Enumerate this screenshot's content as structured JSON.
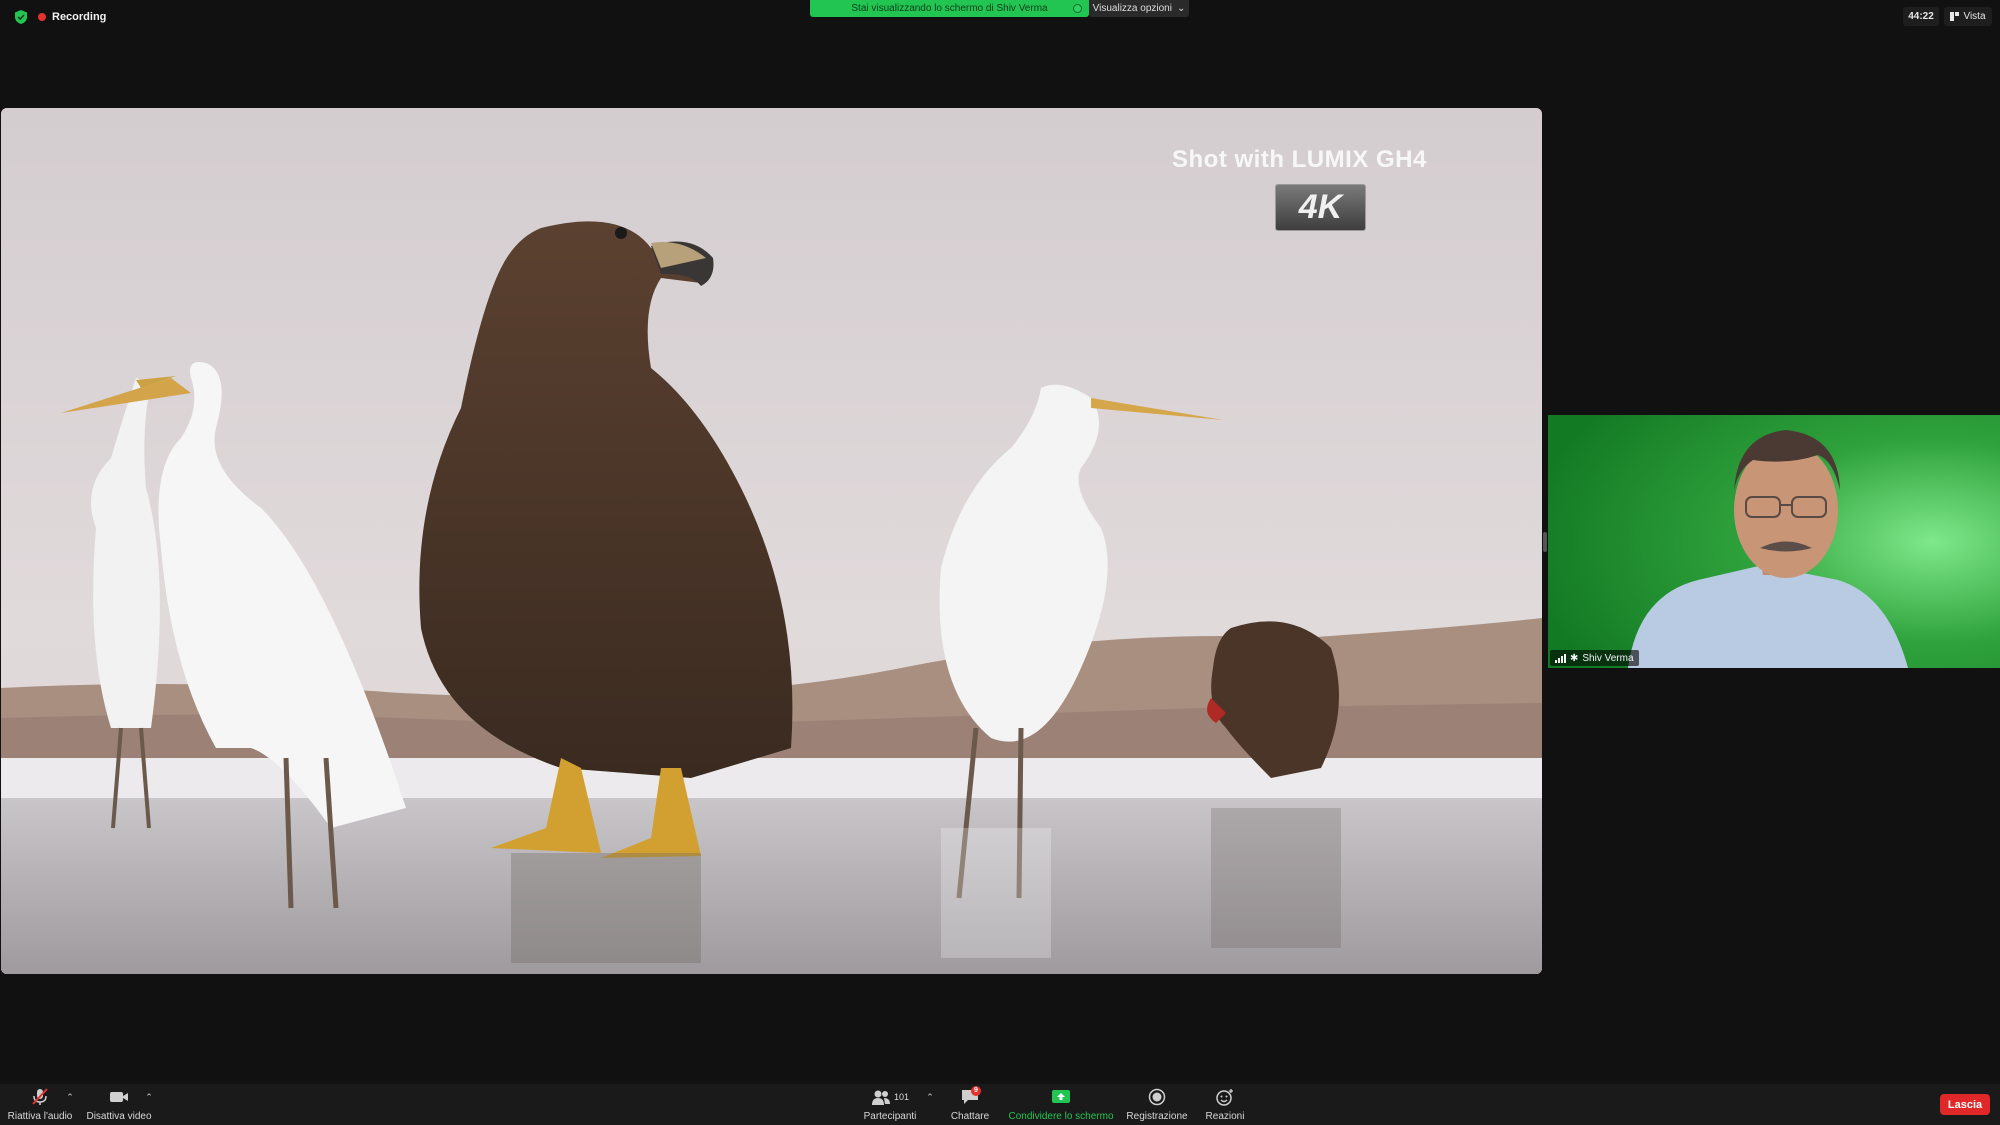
{
  "top_bar": {
    "recording_label": "Recording",
    "share_banner": "Stai visualizzando lo schermo di Shiv Verma",
    "view_options_label": "Visualizza opzioni",
    "meeting_timer": "44:22",
    "view_label": "Vista"
  },
  "shared_content": {
    "overlay_caption": "Shot with LUMIX GH4",
    "resolution_badge": "4K"
  },
  "participant": {
    "name": "Shiv Verma"
  },
  "toolbar": {
    "audio_label": "Riattiva l'audio",
    "video_label": "Disattiva video",
    "participants_label": "Partecipanti",
    "participants_count": "101",
    "chat_label": "Chattare",
    "chat_badge": "9",
    "share_screen_label": "Condividere lo schermo",
    "record_label": "Registrazione",
    "reactions_label": "Reazioni",
    "leave_label": "Lascia"
  },
  "colors": {
    "share_green": "#23c552",
    "leave_red": "#e02828",
    "recording_red": "#e5322d",
    "background": "#111111"
  },
  "icons": [
    "shield-icon",
    "recording-dot-icon",
    "chevron-down-icon",
    "view-icon",
    "microphone-muted-icon",
    "video-camera-icon",
    "participants-icon",
    "chat-icon",
    "share-screen-icon",
    "record-icon",
    "reactions-icon",
    "signal-icon",
    "pin-icon"
  ]
}
